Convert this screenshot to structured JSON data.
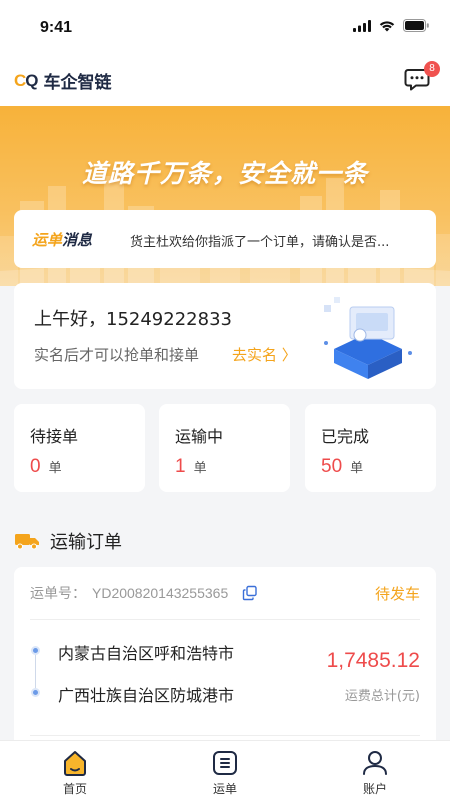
{
  "status_bar": {
    "time": "9:41"
  },
  "header": {
    "logo_mark_c": "C",
    "logo_mark_q": "Q",
    "app_name": "车企智链",
    "message_badge": "8"
  },
  "banner": {
    "slogan": "道路千万条，安全就一条"
  },
  "notice": {
    "tag_prefix": "运单",
    "tag_suffix": "消息",
    "text": "货主杜欢给你指派了一个订单，请确认是否..."
  },
  "greeting": {
    "title": "上午好，15249222833",
    "subtitle": "实名后才可以抢单和接单",
    "verify_link": "去实名 〉"
  },
  "stats": [
    {
      "label": "待接单",
      "value": "0",
      "unit": "单"
    },
    {
      "label": "运输中",
      "value": "1",
      "unit": "单"
    },
    {
      "label": "已完成",
      "value": "50",
      "unit": "单"
    }
  ],
  "section": {
    "title": "运输订单"
  },
  "order": {
    "number_label": "运单号：",
    "number": "YD200820143255365",
    "status": "待发车",
    "from": "内蒙古自治区呼和浩特市",
    "to": "广西壮族自治区防城港市",
    "fee": "1,7485.12",
    "fee_label": "运费总计(元)"
  },
  "tabbar": {
    "items": [
      {
        "label": "首页",
        "icon": "home-icon"
      },
      {
        "label": "运单",
        "icon": "waybill-icon"
      },
      {
        "label": "账户",
        "icon": "account-icon"
      }
    ]
  },
  "colors": {
    "accent": "#f4a41c",
    "highlight_red": "#ee4b4b",
    "brand_navy": "#1f2a44"
  }
}
